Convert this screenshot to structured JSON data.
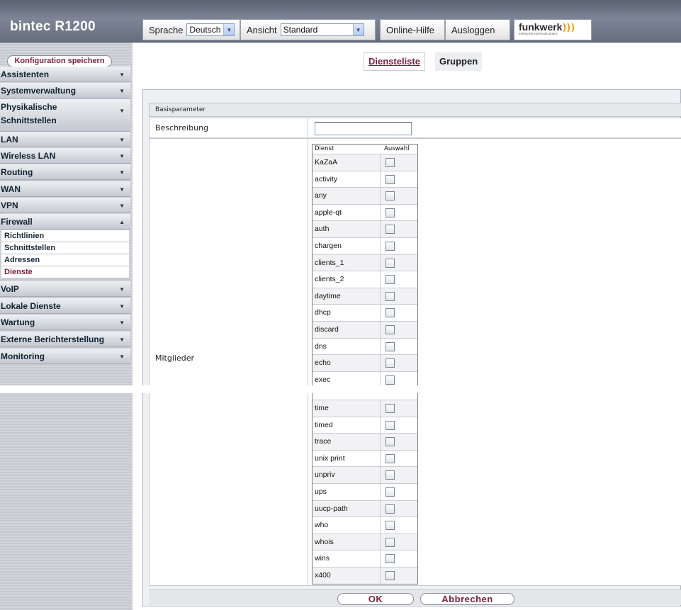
{
  "app": {
    "brand": "bintec R1200",
    "toolbar": {
      "language_label": "Sprache",
      "language_value": "Deutsch",
      "view_label": "Ansicht",
      "view_value": "Standard",
      "help": "Online-Hilfe",
      "logout": "Ausloggen",
      "logo_word": "funkwerk",
      "logo_waves": ")))",
      "logo_tagline": "enterprise communications"
    }
  },
  "sidebar": {
    "save_button": "Konfiguration speichern",
    "items": [
      {
        "label": "Assistenten"
      },
      {
        "label": "Systemverwaltung"
      },
      {
        "label": "Physikalische Schnittstellen"
      },
      {
        "label": "LAN"
      },
      {
        "label": "Wireless LAN"
      },
      {
        "label": "Routing"
      },
      {
        "label": "WAN"
      },
      {
        "label": "VPN"
      },
      {
        "label": "Firewall"
      },
      {
        "label": "VoIP"
      },
      {
        "label": "Lokale Dienste"
      },
      {
        "label": "Wartung"
      },
      {
        "label": "Externe Berichterstellung"
      },
      {
        "label": "Monitoring"
      }
    ],
    "firewall_sub": [
      {
        "label": "Richtlinien"
      },
      {
        "label": "Schnittstellen"
      },
      {
        "label": "Adressen"
      },
      {
        "label": "Dienste"
      }
    ],
    "expanded_item": "Firewall",
    "active_sub": "Dienste"
  },
  "tabs": {
    "diensteliste": "Diensteliste",
    "gruppen": "Gruppen",
    "active": "Gruppen"
  },
  "form": {
    "section_title": "Basisparameter",
    "beschreibung_label": "Beschreibung",
    "beschreibung_value": "",
    "mitglieder_label": "Mitglieder",
    "table_headers": {
      "dienst": "Dienst",
      "auswahl": "Auswahl"
    },
    "services_top": [
      "KaZaA",
      "activity",
      "any",
      "apple-qt",
      "auth",
      "chargen",
      "clients_1",
      "clients_2",
      "daytime",
      "dhcp",
      "discard",
      "dns",
      "echo",
      "exec"
    ],
    "services_bottom": [
      "time",
      "timed",
      "trace",
      "unix print",
      "unpriv",
      "ups",
      "uucp-path",
      "who",
      "whois",
      "wins",
      "x400"
    ],
    "ok": "OK",
    "cancel": "Abbrechen"
  },
  "colors": {
    "accent": "#7a1f3d",
    "topbar": "#6b7282",
    "sidebar": "#cdd0d6"
  }
}
